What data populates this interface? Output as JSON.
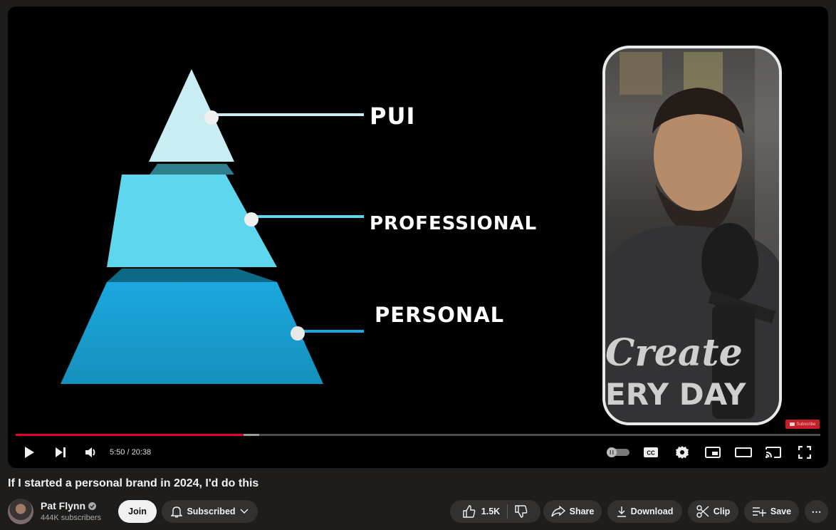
{
  "video": {
    "title": "If I started a personal brand in 2024, I'd do this",
    "pyramid": {
      "levels": [
        {
          "label": "PUI",
          "color": "#c9edf2"
        },
        {
          "label": "PROFESSIONAL",
          "color": "#5dd6ee"
        },
        {
          "label": "PERSONAL",
          "color": "#1a9fd2"
        }
      ]
    },
    "overlay_badge": "Subscribe",
    "shirt_text_line1": "Create",
    "shirt_text_line2": "ERY DAY"
  },
  "player": {
    "current_time": "5:50",
    "duration": "20:38",
    "time_display": "5:50 / 20:38",
    "progress_played_fraction": 0.283,
    "progress_buffered_fraction": 0.303,
    "controls": {
      "play": "play-icon",
      "next": "next-icon",
      "volume": "volume-icon",
      "autoplay": "autoplay-toggle",
      "captions": "CC",
      "settings": "gear-icon",
      "miniplayer": "miniplayer-icon",
      "theater": "theater-icon",
      "cast": "cast-icon",
      "fullscreen": "fullscreen-icon"
    }
  },
  "channel": {
    "name": "Pat Flynn",
    "subscribers": "444K subscribers",
    "verified": true,
    "join_label": "Join",
    "subscribed_label": "Subscribed"
  },
  "actions": {
    "likes": "1.5K",
    "share": "Share",
    "download": "Download",
    "clip": "Clip",
    "save": "Save",
    "more": "⋯"
  },
  "colors": {
    "progress_red": "#e1002d",
    "page_bg": "#1f1d1b",
    "pill_bg": "#333130"
  }
}
